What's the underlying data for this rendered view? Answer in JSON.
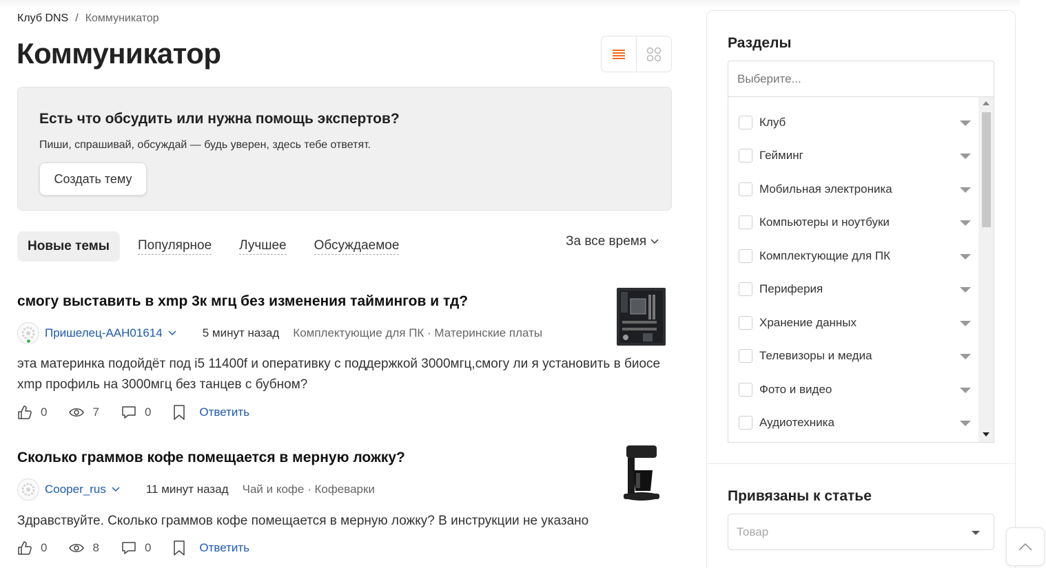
{
  "breadcrumb": {
    "home": "Клуб DNS",
    "separator": "/",
    "current": "Коммуникатор"
  },
  "page": {
    "title": "Коммуникатор"
  },
  "view_switch": {
    "active": "list",
    "list_icon": "list-icon",
    "grid_icon": "grid-icon"
  },
  "promo": {
    "title": "Есть что обсудить или нужна помощь экспертов?",
    "subtitle": "Пиши, спрашивай, обсуждай — будь уверен, здесь тебе ответят.",
    "button": "Создать тему"
  },
  "tabs": [
    {
      "label": "Новые темы",
      "active": true
    },
    {
      "label": "Популярное",
      "active": false
    },
    {
      "label": "Лучшее",
      "active": false
    },
    {
      "label": "Обсуждаемое",
      "active": false
    }
  ],
  "period": {
    "label": "За все время"
  },
  "posts": [
    {
      "title": "смогу выставить в xmp 3к мгц без изменения таймингов и тд?",
      "author": "Пришелец-AAH01614",
      "online": true,
      "time": "5 минут назад",
      "category": "Комплектующие для ПК · Материнские платы",
      "body": "эта материнка подойдёт под i5 11400f и оперативку с поддержкой 3000мгц,смогу ли я установить в биосе xmp профиль на 3000мгц без танцев с бубном?",
      "likes": "0",
      "views": "7",
      "comments": "0",
      "reply": "Ответить",
      "thumb": "motherboard-image"
    },
    {
      "title": "Сколько граммов кофе помещается в мерную ложку?",
      "author": "Cooper_rus",
      "online": false,
      "time": "11 минут назад",
      "category": "Чай и кофе · Кофеварки",
      "body": "Здравствуйте. Сколько граммов кофе помещается в мерную ложку? В инструкции не указано",
      "likes": "0",
      "views": "8",
      "comments": "0",
      "reply": "Ответить",
      "thumb": "coffee-maker-image"
    }
  ],
  "sidebar": {
    "sections_title": "Разделы",
    "search_placeholder": "Выберите...",
    "sections": [
      "Клуб",
      "Гейминг",
      "Мобильная электроника",
      "Компьютеры и ноутбуки",
      "Комплектующие для ПК",
      "Периферия",
      "Хранение данных",
      "Телевизоры и медиа",
      "Фото и видео",
      "Аудиотехника"
    ],
    "linked_title": "Привязаны к статье",
    "linked_placeholder": "Товар"
  },
  "colors": {
    "accent": "#f26a1b",
    "link": "#1d5ab0",
    "online": "#3bb54a"
  }
}
